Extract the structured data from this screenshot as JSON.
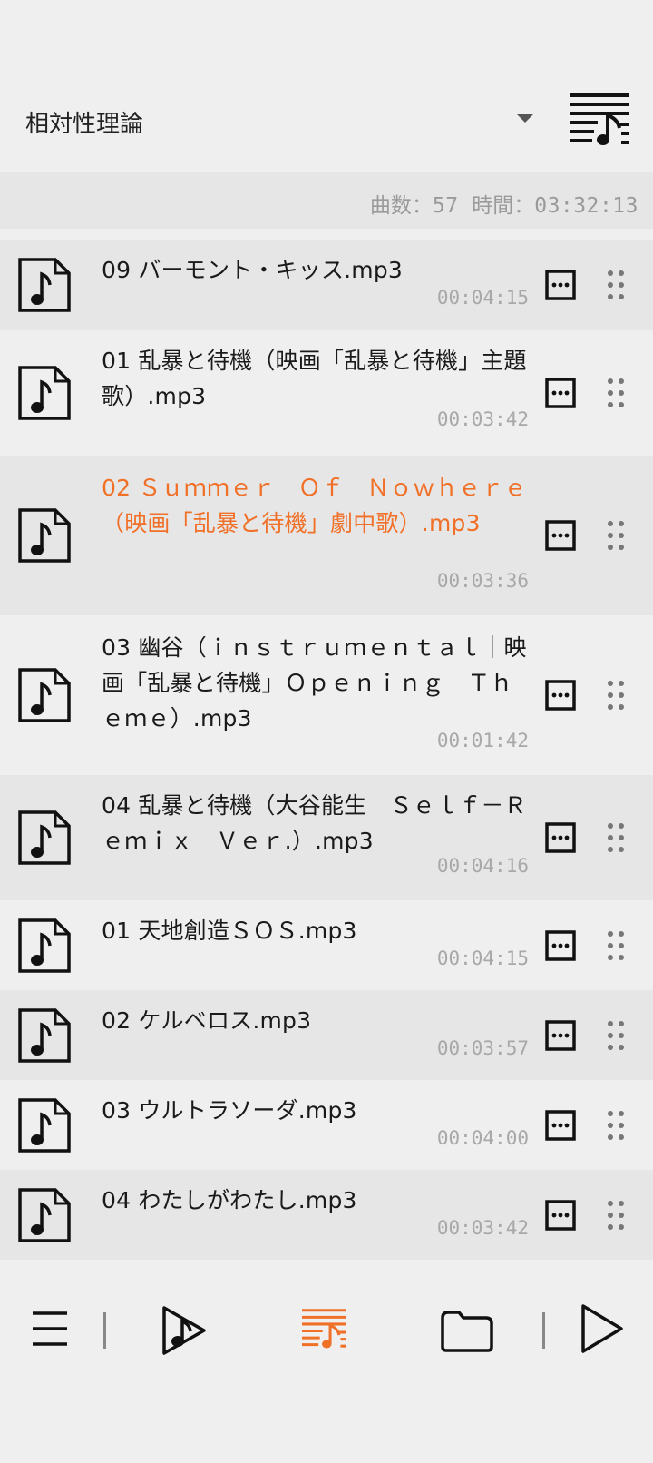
{
  "header": {
    "playlist_name": "相対性理論"
  },
  "summary": {
    "count_label": "曲数：",
    "count_value": "57",
    "time_label": "時間：",
    "time_value": "03:32:13"
  },
  "tracks": [
    {
      "title": "09 バーモント・キッス.mp3",
      "duration": "00:04:15"
    },
    {
      "title": "01 乱暴と待機（映画「乱暴と待機」主題歌）.mp3",
      "duration": "00:03:42"
    },
    {
      "title": "02 Ｓｕｍｍｅｒ　Ｏｆ　Ｎｏｗｈｅｒｅ（映画「乱暴と待機」劇中歌）.mp3",
      "duration": "00:03:36"
    },
    {
      "title": "03 幽谷（ｉｎｓｔｒｕｍｅｎｔａｌ｜映画「乱暴と待機」Ｏｐｅｎｉｎｇ　Ｔｈｅｍｅ）.mp3",
      "duration": "00:01:42"
    },
    {
      "title": "04 乱暴と待機（大谷能生　Ｓｅｌｆ－Ｒｅｍｉｘ　Ｖｅｒ.）.mp3",
      "duration": "00:04:16"
    },
    {
      "title": "01 天地創造ＳＯＳ.mp3",
      "duration": "00:04:15"
    },
    {
      "title": "02 ケルベロス.mp3",
      "duration": "00:03:57"
    },
    {
      "title": "03 ウルトラソーダ.mp3",
      "duration": "00:04:00"
    },
    {
      "title": "04 わたしがわたし.mp3",
      "duration": "00:03:42"
    }
  ],
  "active_index": 2,
  "colors": {
    "accent": "#f07028",
    "text": "#1a1a1a",
    "muted": "#a8a8a8",
    "row_alt": "#e6e6e6",
    "background": "#efefef"
  },
  "bottom_nav": {
    "items": [
      "menu-icon",
      "music-play-icon",
      "playlist-icon",
      "folder-icon",
      "play-icon"
    ],
    "active": "playlist-icon"
  }
}
